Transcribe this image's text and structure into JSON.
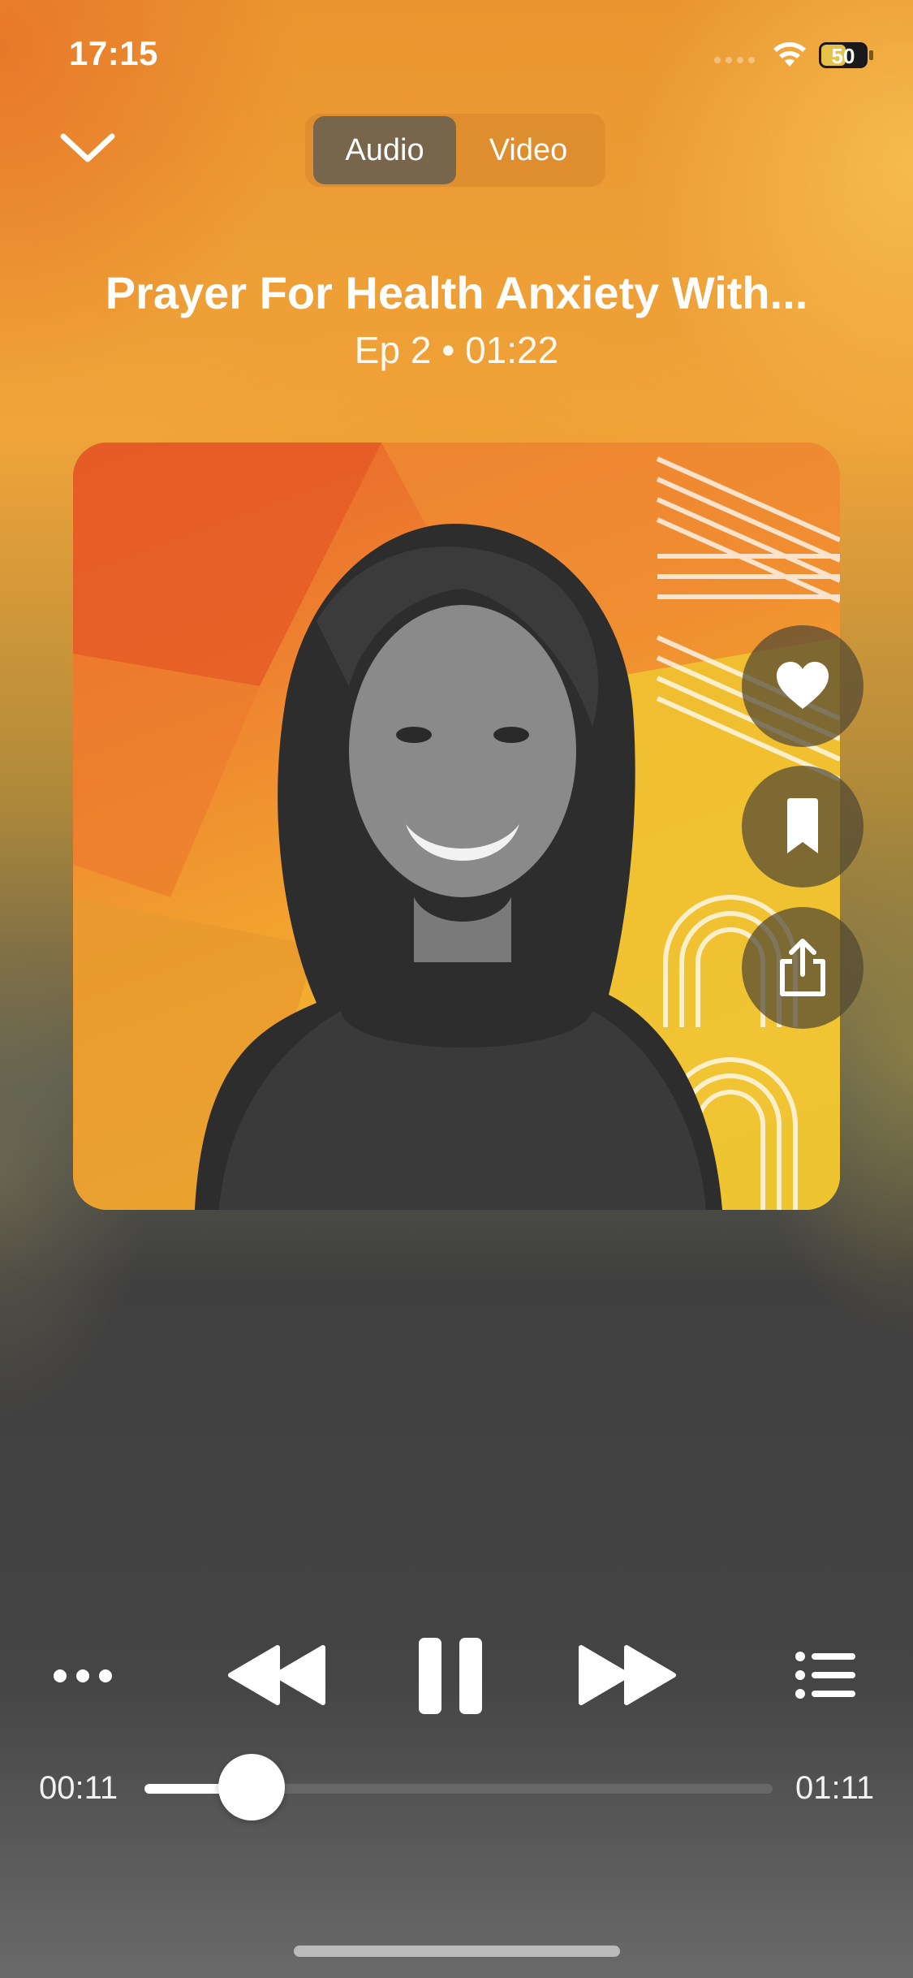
{
  "status_bar": {
    "time": "17:15",
    "battery": "50"
  },
  "mode_toggle": {
    "options": [
      "Audio",
      "Video"
    ],
    "selected": "Audio"
  },
  "episode": {
    "title": "Prayer For Health Anxiety With...",
    "meta": "Ep 2 • 01:22"
  },
  "artwork": {
    "description_icon": "podcast-cover-art"
  },
  "side_actions": [
    {
      "name": "like",
      "icon": "heart-icon"
    },
    {
      "name": "save",
      "icon": "bookmark-icon"
    },
    {
      "name": "share",
      "icon": "share-icon"
    }
  ],
  "controls": {
    "more_icon": "ellipsis-icon",
    "rewind_icon": "rewind-icon",
    "play_state": "playing",
    "pause_icon": "pause-icon",
    "forward_icon": "fast-forward-icon",
    "queue_icon": "list-icon"
  },
  "progress": {
    "elapsed": "00:11",
    "total": "01:11",
    "fraction": 0.17
  },
  "colors": {
    "accent_orange": "#ef8430",
    "accent_yellow": "#f1c534",
    "control_bg": "#3f3f3f"
  }
}
